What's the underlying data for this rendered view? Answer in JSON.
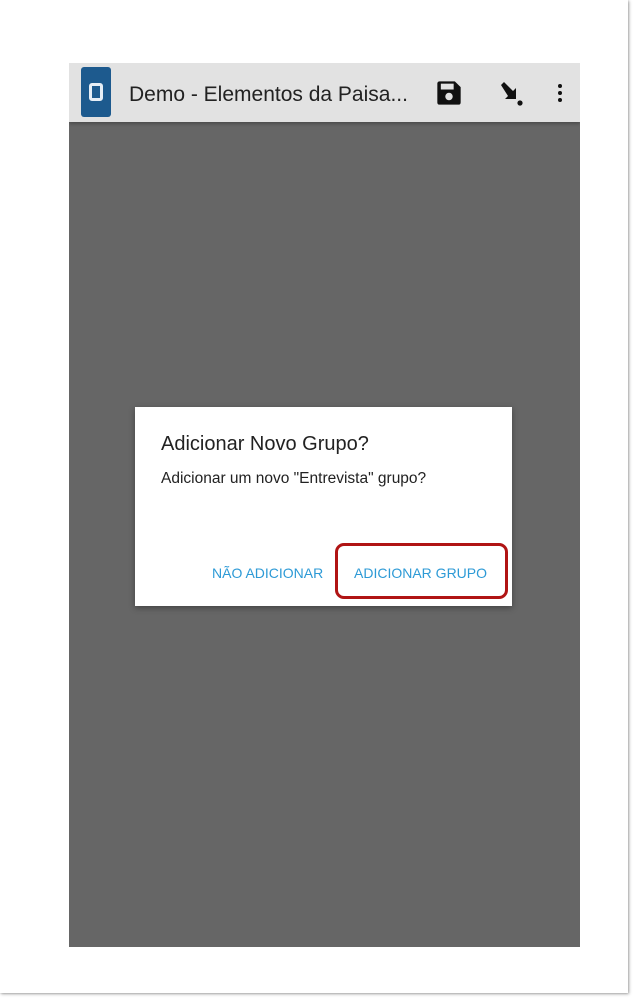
{
  "app": {
    "title": "Demo - Elementos da Paisa..."
  },
  "toolbar": {
    "logo_icon": "app-logo-icon",
    "actions": [
      {
        "icon": "save-icon"
      },
      {
        "icon": "export-arrow-icon"
      },
      {
        "icon": "more-vert-icon"
      }
    ]
  },
  "dialog": {
    "title": "Adicionar Novo Grupo?",
    "message": "Adicionar um novo \"Entrevista\" grupo?",
    "negative_button": "NÃO ADICIONAR",
    "positive_button": "ADICIONAR GRUPO",
    "highlighted_button": "ADICIONAR GRUPO"
  },
  "colors": {
    "scrim": "#666666",
    "action_bar": "#e2e2e2",
    "logo": "#1d5a8e",
    "button_text": "#2d9ad6",
    "highlight": "#b01414"
  }
}
